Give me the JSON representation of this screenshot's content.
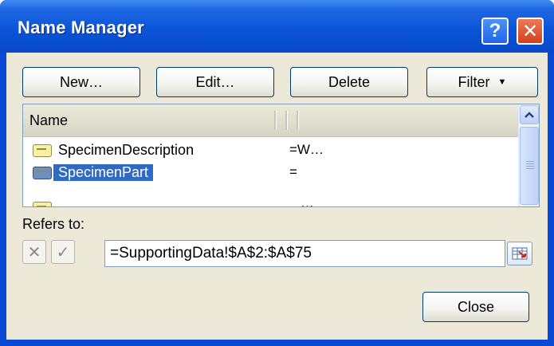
{
  "window": {
    "title": "Name Manager"
  },
  "title_buttons": {
    "help": "?",
    "close": "✕"
  },
  "toolbar": {
    "new_label": "New…",
    "edit_label": "Edit…",
    "delete_label": "Delete",
    "filter_label": "Filter"
  },
  "list": {
    "header": {
      "name": "Name"
    },
    "rows": [
      {
        "name": "SpecimenDescription",
        "value": "=W…",
        "selected": false
      },
      {
        "name": "SpecimenPart",
        "value": "=",
        "selected": true
      },
      {
        "name": "",
        "value": "…",
        "selected": false
      }
    ]
  },
  "refers_to": {
    "label": "Refers to:",
    "value": "=SupportingData!$A$2:$A$75"
  },
  "footer": {
    "close_label": "Close"
  },
  "colors": {
    "titlebar": "#0a55d8",
    "selection": "#316ac5",
    "dialog_bg": "#ece9d8"
  }
}
